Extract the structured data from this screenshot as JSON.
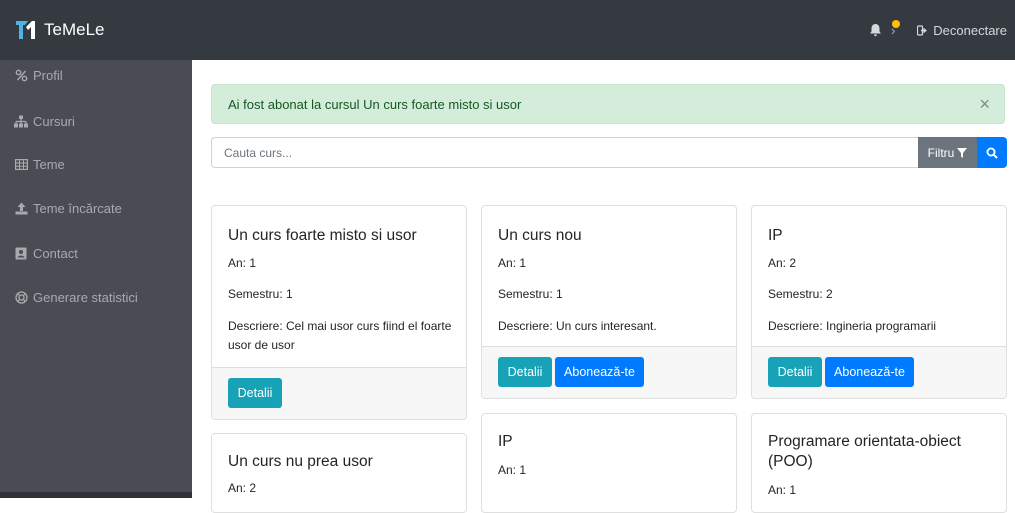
{
  "app": {
    "title": "TeMeLe"
  },
  "navbar": {
    "logout_label": "Deconectare"
  },
  "sidebar": {
    "items": [
      {
        "label": "Profil",
        "icon": "profile-icon"
      },
      {
        "label": "Cursuri",
        "icon": "sitemap-icon"
      },
      {
        "label": "Teme",
        "icon": "table-icon"
      },
      {
        "label": "Teme încărcate",
        "icon": "upload-icon"
      },
      {
        "label": "Contact",
        "icon": "address-book-icon"
      },
      {
        "label": "Generare statistici",
        "icon": "life-ring-icon"
      }
    ]
  },
  "alert": {
    "message": "Ai fost abonat la cursul Un curs foarte misto si usor",
    "close_symbol": "×"
  },
  "search": {
    "placeholder": "Cauta curs...",
    "filter_label": "Filtru"
  },
  "courses": [
    {
      "title": "Un curs foarte misto si usor",
      "year": "An: 1",
      "semester": "Semestru: 1",
      "description": "Descriere: Cel mai usor curs fiind el foarte usor de usor",
      "details_label": "Detalii"
    },
    {
      "title": "Un curs nou",
      "year": "An: 1",
      "semester": "Semestru: 1",
      "description": "Descriere: Un curs interesant.",
      "details_label": "Detalii",
      "subscribe_label": "Abonează-te"
    },
    {
      "title": "IP",
      "year": "An: 2",
      "semester": "Semestru: 2",
      "description": "Descriere: Ingineria programarii",
      "details_label": "Detalii",
      "subscribe_label": "Abonează-te"
    },
    {
      "title": "Un curs nu prea usor",
      "year": "An: 2"
    },
    {
      "title": "IP",
      "year": "An: 1"
    },
    {
      "title": "Programare orientata-obiect (POO)",
      "year": "An: 1"
    }
  ],
  "colors": {
    "navbar": "#343a40",
    "sidebar": "#494d53",
    "alert_bg": "#d4edda",
    "alert_text": "#155724",
    "primary": "#007bff",
    "info": "#17a2b8",
    "secondary": "#6c757d",
    "notification_dot": "#ffc107"
  }
}
